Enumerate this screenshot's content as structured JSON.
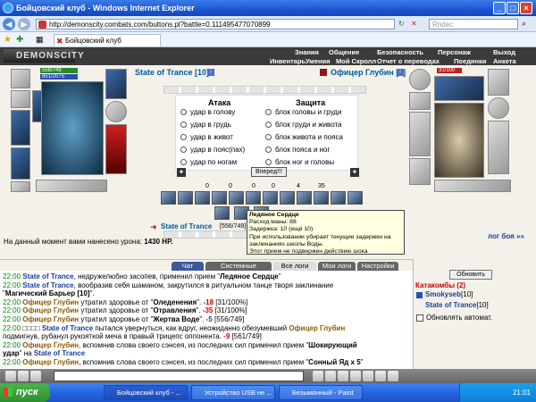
{
  "window": {
    "title": "Бойцовский клуб - Windows Internet Explorer"
  },
  "browser": {
    "url": "http://demonscity.combats.com/buttons.pl?battle=0.111495477070899",
    "search_placeholder": "Rndec",
    "tab_title": "Бойцовский клуб"
  },
  "game": {
    "logo": "DEMONSCITY",
    "menu_top": [
      "Знания",
      "Общение",
      "Безопасность",
      "Персонаж",
      "Выход"
    ],
    "menu_bottom": [
      "Инвентарь",
      "Умения",
      "Мой Скролл",
      "Отчет о переводах",
      "Поединки",
      "Анкета"
    ]
  },
  "left_player": {
    "name": "State of Trance",
    "level": "[10]",
    "hp": "556/749",
    "mana": "851/2075"
  },
  "right_player": {
    "name": "Офицер Глубин",
    "level": "[8]",
    "hp": "31/100"
  },
  "attack": {
    "title": "Атака",
    "options": [
      "удар в голову",
      "удар в грудь",
      "удар в живот",
      "удар в пояс(пах)",
      "удар по ногам"
    ]
  },
  "defense": {
    "title": "Защита",
    "options": [
      "блок головы и груди",
      "блок груди и живота",
      "блок живота и пояса",
      "блок пояса и ног",
      "блок ног и головы"
    ]
  },
  "forward_button": "Вперед!!!",
  "counters": [
    "0",
    "0",
    "0",
    "0",
    "4",
    "35"
  ],
  "bottom_player_name": "State of Trance",
  "bottom_player_hp": "[556/749]",
  "damage_text": "На данный момент вами нанесено урона:",
  "damage_value": "1430 HP.",
  "battle_log_link": "лог боя »»",
  "tooltip": {
    "title": "Ледяное Сердце",
    "line1": "Расход маны: 88",
    "line2": "Задержка: 10 (ещё 10)",
    "line3": "При использовании убирает текущие задержки на заклинаниях школы Воды.",
    "line4": "Этот прием не подвержен действию шока"
  },
  "chat_tabs": [
    "Чат",
    "Системные сообщения",
    "Все логи",
    "Мои логи",
    "Настройки"
  ],
  "chat": [
    {
      "time": "22:00",
      "a": "State of Trance",
      "t": ", недружелюбно засопев, применил прием \""
    },
    {
      "time": "22:00",
      "a": "State of Trance",
      "t": ", вообразив себя шаманом, закрутился в ритуальном танце творя заклинание"
    },
    {
      "time": "",
      "a": "",
      "t": ""
    },
    {
      "time": "22:00",
      "a": "Офицер Глубин",
      "t": " утратил здоровье от \""
    },
    {
      "time": "22:00",
      "a": "Офицер Глубин",
      "t": " утратил здоровье от \""
    },
    {
      "time": "22:00",
      "a": "Офицер Глубин",
      "t": " утратил здоровье от \""
    },
    {
      "time": "22:00",
      "a": "State of Trance",
      "t": " пытался увернуться, как вдруг, неожиданно обезумевший"
    },
    {
      "time": "",
      "a": "",
      "t": "подмигнув, рубанул рукояткой меча в правый трицепс оппонента."
    },
    {
      "time": "22:00",
      "a": "Офицер Глубин",
      "t": ", вспомнив слова своего сэнсея, из последних сил применил прием \""
    },
    {
      "time": "",
      "a": "",
      "t": ""
    },
    {
      "time": "22:00",
      "a": "Офицер Глубин",
      "t": ", вспомнив слова своего сэнсея, из последних сил применил прием \""
    }
  ],
  "chat_extra": {
    "l1_spell": "Ледяное Сердце",
    "l2_spell": "Магический Барьер [10]",
    "l3_e": "Оледенения",
    "l3_n": "-18",
    "l3_h": "[31/100%]",
    "l4_e": "Отравления",
    "l4_n": "-35",
    "l4_h": "[31/100%]",
    "l5_e": "Жертва Воде",
    "l5_n": "-5",
    "l5_h": "[556/749]",
    "l6_b": "Офицер Глубин",
    "l7_n": "-9",
    "l7_h": "[561/749]",
    "l8_spell": "Шокирующий",
    "l9_rest": "удар",
    "l9_on": "на",
    "l9_target": "State of Trance",
    "l10_spell": "Сонный Яд х 5"
  },
  "right_panel": {
    "refresh": "Обновить",
    "location": "Катакомбы (2)",
    "player1": "Smokyseb",
    "player1_lvl": "[10]",
    "player2": "State of Trance",
    "player2_lvl": "[10]",
    "auto": "Обновлять автомат."
  },
  "taskbar": {
    "start": "пуск",
    "tasks": [
      "Бойцовский клуб - ...",
      "Устройство USB не ...",
      "Безымянный - Paint"
    ],
    "time": "21:01"
  },
  "colors": {
    "hp": "#2a8a2a",
    "mana": "#2a4fb0",
    "enemy_hp": "#c02020"
  }
}
